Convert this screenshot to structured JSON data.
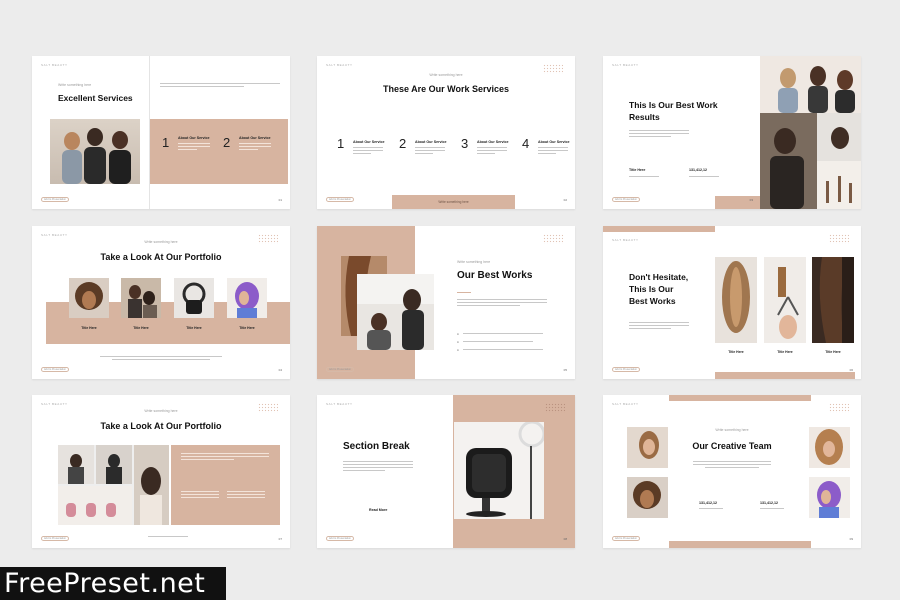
{
  "watermark": "FreePreset.net",
  "colors": {
    "accent": "#d7b4a0",
    "background": "#ececec"
  },
  "common": {
    "kicker": "Write something here",
    "pill_label": "Add to Presentation",
    "brand": "SALT BEAUTY"
  },
  "slide1": {
    "kicker": "Write something here",
    "title": "Excellent Services",
    "services": [
      {
        "num": "1",
        "name": "About Our Service"
      },
      {
        "num": "2",
        "name": "About Our Service"
      }
    ],
    "page": "01"
  },
  "slide2": {
    "kicker": "Write something here",
    "title": "These Are Our Work Services",
    "services": [
      {
        "num": "1",
        "name": "About Our Service"
      },
      {
        "num": "2",
        "name": "About Our Service"
      },
      {
        "num": "3",
        "name": "About Our Service"
      },
      {
        "num": "4",
        "name": "About Our Service"
      }
    ],
    "bar_label": "Write something here",
    "page": "02"
  },
  "slide3": {
    "title_line1": "This Is Our Best Work",
    "title_line2": "Results",
    "stat_label": "Title Here",
    "stat_value": "131,412,12",
    "page": "03"
  },
  "slide4": {
    "kicker": "Write something here",
    "title": "Take a Look At Our Portfolio",
    "captions": [
      "Title Here",
      "Title Here",
      "Title Here",
      "Title Here"
    ],
    "page": "04"
  },
  "slide5": {
    "kicker": "Write something here",
    "title": "Our Best Works",
    "page": "05"
  },
  "slide6": {
    "title_line1": "Don't Hesitate,",
    "title_line2": "This Is Our",
    "title_line3": "Best Works",
    "captions": [
      "Title Here",
      "Title Here",
      "Title Here"
    ],
    "page": "06"
  },
  "slide7": {
    "kicker": "Write something here",
    "title": "Take a Look At Our Portfolio",
    "page": "07"
  },
  "slide8": {
    "title": "Section Break",
    "read_more": "Read More",
    "page": "08"
  },
  "slide9": {
    "kicker": "Write something here",
    "title": "Our Creative Team",
    "stat_value_1": "131,412,12",
    "stat_value_2": "131,412,12",
    "page": "09"
  }
}
